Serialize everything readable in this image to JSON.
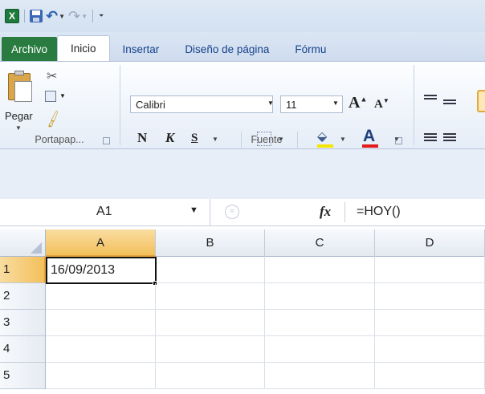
{
  "quick_access": {
    "app_icon": "excel-logo-icon",
    "app_letter": "X",
    "save_icon": "save-icon",
    "undo_icon": "undo-icon",
    "redo_icon": "redo-icon"
  },
  "tabs": [
    {
      "label": "Archivo"
    },
    {
      "label": "Inicio"
    },
    {
      "label": "Insertar"
    },
    {
      "label": "Diseño de página"
    },
    {
      "label": "Fórmu"
    }
  ],
  "ribbon": {
    "clipboard": {
      "paste_label": "Pegar",
      "group_label": "Portapap..."
    },
    "font": {
      "font_name": "Calibri",
      "font_size": "11",
      "bold": "N",
      "italic": "K",
      "underline": "S",
      "font_color_letter": "A",
      "grow_letter": "A",
      "shrink_letter": "A",
      "group_label": "Fuente"
    }
  },
  "formula_bar": {
    "name_box": "A1",
    "fx_label": "fx",
    "formula": "=HOY()"
  },
  "grid": {
    "columns": [
      "A",
      "B",
      "C",
      "D"
    ],
    "rows": [
      "1",
      "2",
      "3",
      "4",
      "5"
    ],
    "active_cell": "A1",
    "cells": {
      "A1": "16/09/2013"
    }
  },
  "colors": {
    "file_tab": "#2a7b3f",
    "selected_header": "#f3c05b",
    "font_color_bar": "#e21b1b",
    "fill_color_bar": "#f5e600"
  }
}
